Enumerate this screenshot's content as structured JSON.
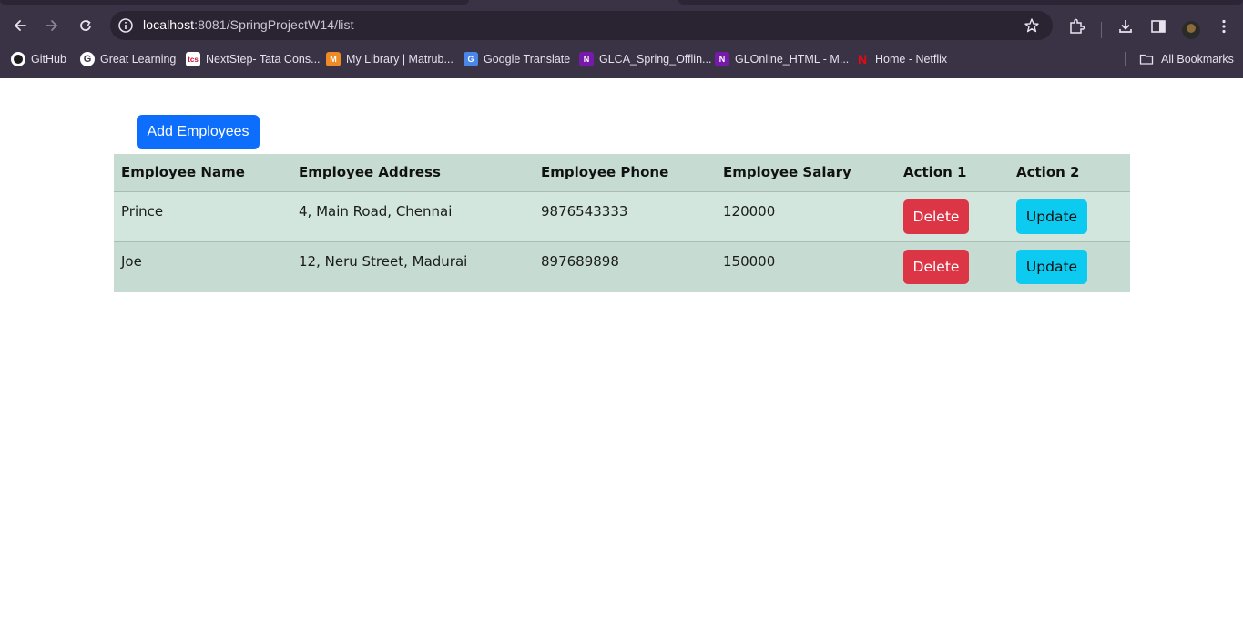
{
  "browser": {
    "url_host": "localhost",
    "url_rest": ":8081/SpringProjectW14/list",
    "bookmarks": [
      {
        "label": "GitHub",
        "icon": "github-icon"
      },
      {
        "label": "Great Learning",
        "icon": "google-icon"
      },
      {
        "label": "NextStep- Tata Cons...",
        "icon": "tcs-icon"
      },
      {
        "label": "My Library | Matrub...",
        "icon": "matrubharti-icon"
      },
      {
        "label": "Google Translate",
        "icon": "google-translate-icon"
      },
      {
        "label": "GLCA_Spring_Offlin...",
        "icon": "onenote-icon"
      },
      {
        "label": "GLOnline_HTML - M...",
        "icon": "onenote-icon"
      },
      {
        "label": "Home - Netflix",
        "icon": "netflix-icon"
      }
    ],
    "all_bookmarks_label": "All Bookmarks"
  },
  "page": {
    "add_button_label": "Add Employees",
    "table": {
      "headers": [
        "Employee Name",
        "Employee Address",
        "Employee Phone",
        "Employee Salary",
        "Action 1",
        "Action 2"
      ],
      "rows": [
        {
          "name": "Prince",
          "address": "4, Main Road, Chennai",
          "phone": "9876543333",
          "salary": "120000",
          "delete_label": "Delete",
          "update_label": "Update"
        },
        {
          "name": "Joe",
          "address": "12, Neru Street, Madurai",
          "phone": "897689898",
          "salary": "150000",
          "delete_label": "Delete",
          "update_label": "Update"
        }
      ]
    }
  },
  "colors": {
    "primary": "#0d6efd",
    "danger": "#dc3545",
    "info": "#0dcaf0",
    "table_row": "#d2e6dd",
    "chrome_bg": "#3a3346"
  }
}
